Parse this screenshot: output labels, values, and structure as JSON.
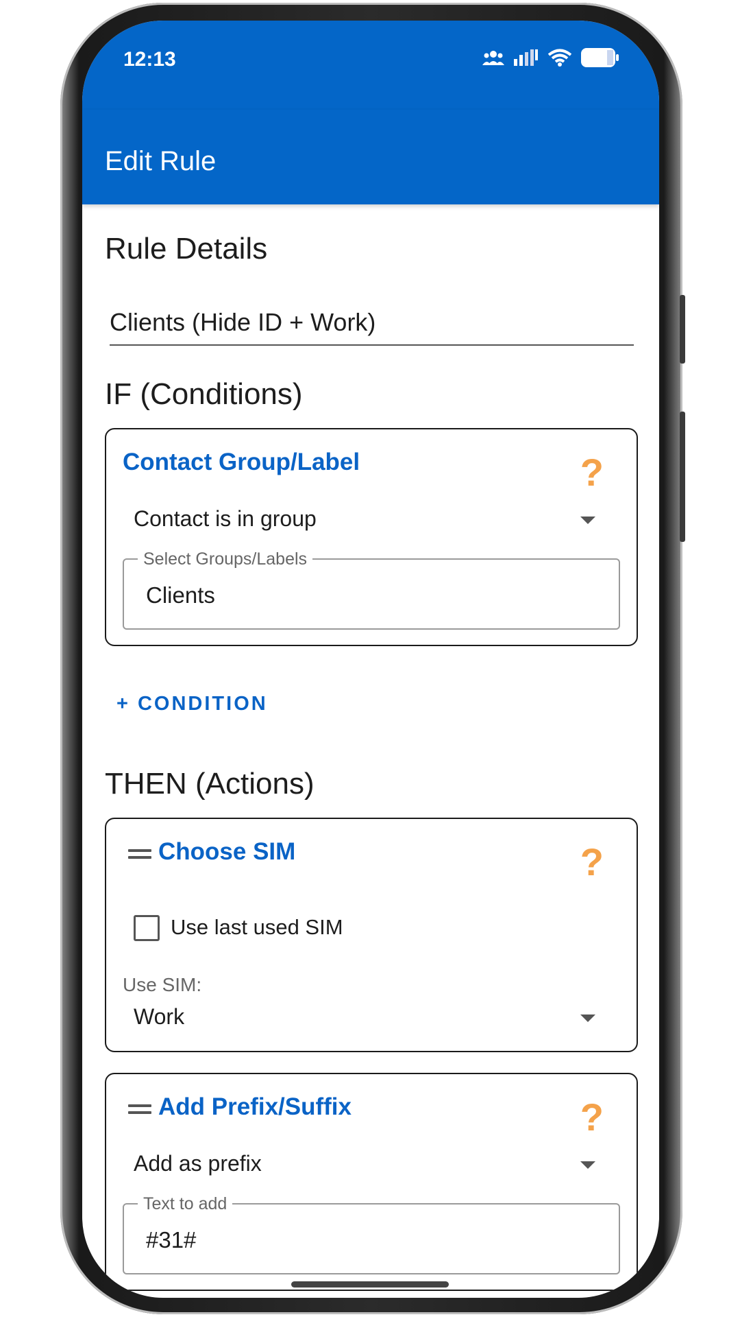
{
  "status_bar": {
    "time": "12:13",
    "icons": [
      "people-icon",
      "signal-icon",
      "wifi-icon",
      "battery-icon"
    ]
  },
  "app_bar": {
    "title": "Edit Rule"
  },
  "rule_details": {
    "heading": "Rule Details",
    "name_value": "Clients (Hide ID + Work)"
  },
  "conditions": {
    "heading": "IF (Conditions)",
    "card": {
      "title": "Contact Group/Label",
      "help": "?",
      "select_value": "Contact is in group",
      "field_label": "Select Groups/Labels",
      "field_value": "Clients"
    },
    "add_label": "+ CONDITION"
  },
  "actions": {
    "heading": "THEN (Actions)",
    "sim_card": {
      "title": "Choose SIM",
      "help": "?",
      "checkbox_label": "Use last used SIM",
      "checkbox_checked": false,
      "sim_label": "Use SIM:",
      "sim_value": "Work"
    },
    "prefix_card": {
      "title": "Add Prefix/Suffix",
      "help": "?",
      "select_value": "Add as prefix",
      "field_label": "Text to add",
      "field_value": "#31#"
    }
  },
  "colors": {
    "primary": "#0466c8",
    "accent_title": "#0a63c6",
    "help": "#f4a24a"
  }
}
